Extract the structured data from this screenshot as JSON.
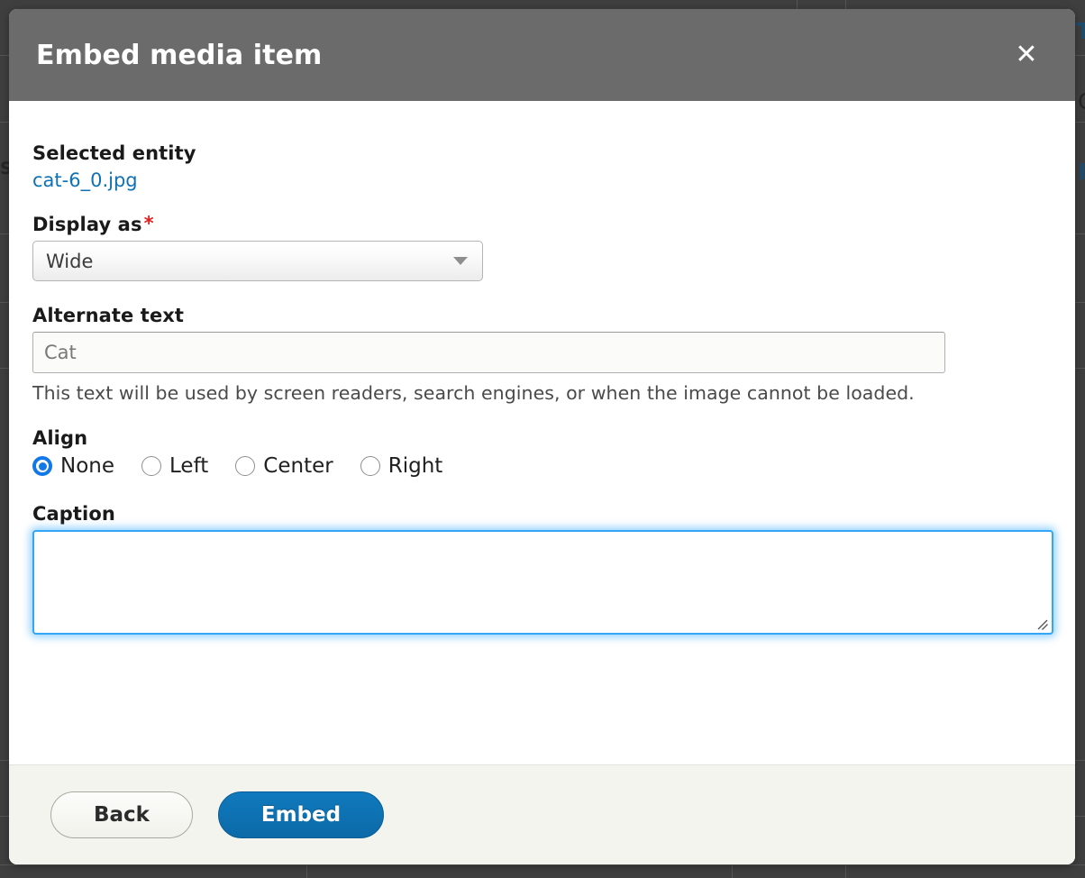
{
  "modal": {
    "title": "Embed media item",
    "close_icon": "close-icon",
    "close_glyph": "✕"
  },
  "form": {
    "selected_entity": {
      "label": "Selected entity",
      "file_name": "cat-6_0.jpg"
    },
    "display_as": {
      "label": "Display as",
      "required_mark": "*",
      "value": "Wide",
      "options": [
        "Wide"
      ],
      "arrow_icon": "chevron-down-icon"
    },
    "alternate_text": {
      "label": "Alternate text",
      "value": "",
      "placeholder": "Cat",
      "description": "This text will be used by screen readers, search engines, or when the image cannot be loaded."
    },
    "align": {
      "label": "Align",
      "selected": "None",
      "options": [
        {
          "label": "None",
          "selected": true
        },
        {
          "label": "Left",
          "selected": false
        },
        {
          "label": "Center",
          "selected": false
        },
        {
          "label": "Right",
          "selected": false
        }
      ]
    },
    "caption": {
      "label": "Caption",
      "value": "",
      "placeholder": "",
      "focused": true,
      "resize_icon": "resize-grip-icon"
    }
  },
  "footer": {
    "back_label": "Back",
    "embed_label": "Embed"
  },
  "background": {
    "glyph_top_right": "T",
    "glyph_mid_right": "C",
    "glyph_low_right": "I",
    "glyph_left": "S"
  },
  "colors": {
    "header_bg": "#6b6b6b",
    "link": "#0f72b5",
    "required": "#e02020",
    "radio_selected": "#1278e8",
    "focus_ring": "#33a6f5",
    "primary_button": "#0c6aa8",
    "footer_bg": "#f4f4ef",
    "backdrop": "#3f3f3f"
  }
}
